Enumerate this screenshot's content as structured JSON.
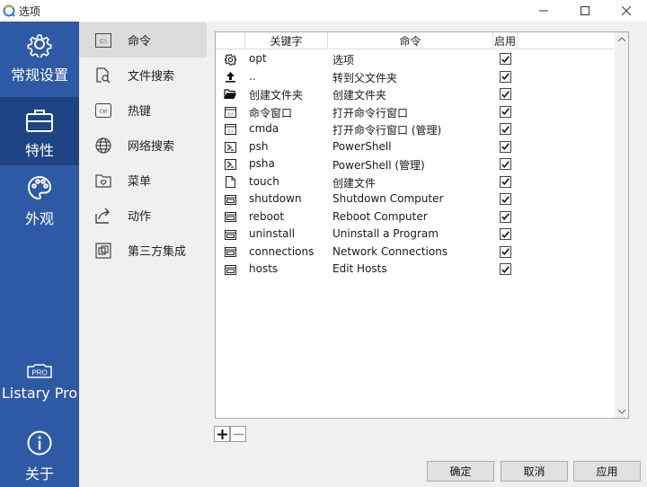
{
  "window": {
    "title": "选项"
  },
  "sidebar": {
    "items": [
      {
        "label": "常规设置",
        "icon": "gear-icon"
      },
      {
        "label": "特性",
        "icon": "briefcase-icon"
      },
      {
        "label": "外观",
        "icon": "palette-icon"
      },
      {
        "label": "Listary Pro",
        "icon": "pro-badge-icon",
        "badge": "PRO"
      },
      {
        "label": "关于",
        "icon": "info-icon"
      }
    ],
    "active_index": 1
  },
  "subnav": {
    "items": [
      {
        "label": "命令",
        "icon": "command-window-icon"
      },
      {
        "label": "文件搜索",
        "icon": "file-search-icon"
      },
      {
        "label": "热键",
        "icon": "keyboard-key-icon",
        "badge": "Ctrl"
      },
      {
        "label": "网络搜索",
        "icon": "globe-icon"
      },
      {
        "label": "菜单",
        "icon": "folder-heart-icon"
      },
      {
        "label": "动作",
        "icon": "share-arrow-icon"
      },
      {
        "label": "第三方集成",
        "icon": "windows-stack-icon"
      }
    ],
    "active_index": 0
  },
  "table": {
    "headers": [
      "关键字",
      "命令",
      "启用"
    ],
    "rows": [
      {
        "icon": "gear-icon",
        "keyword": "opt",
        "command": "选项",
        "enabled": true
      },
      {
        "icon": "up-arrow-icon",
        "keyword": "..",
        "command": "转到父文件夹",
        "enabled": true
      },
      {
        "icon": "open-folder-icon",
        "keyword": "创建文件夹",
        "command": "创建文件夹",
        "enabled": true
      },
      {
        "icon": "cmd-icon",
        "keyword": "命令窗口",
        "command": "打开命令行窗口",
        "enabled": true
      },
      {
        "icon": "cmd-icon",
        "keyword": "cmda",
        "command": "打开命令行窗口 (管理)",
        "enabled": true
      },
      {
        "icon": "powershell-icon",
        "keyword": "psh",
        "command": "PowerShell",
        "enabled": true
      },
      {
        "icon": "powershell-icon",
        "keyword": "psha",
        "command": "PowerShell (管理)",
        "enabled": true
      },
      {
        "icon": "file-icon",
        "keyword": "touch",
        "command": "创建文件",
        "enabled": true
      },
      {
        "icon": "run-window-icon",
        "keyword": "shutdown",
        "command": "Shutdown Computer",
        "enabled": true
      },
      {
        "icon": "run-window-icon",
        "keyword": "reboot",
        "command": "Reboot Computer",
        "enabled": true
      },
      {
        "icon": "run-window-icon",
        "keyword": "uninstall",
        "command": "Uninstall a Program",
        "enabled": true
      },
      {
        "icon": "run-window-icon",
        "keyword": "connections",
        "command": "Network Connections",
        "enabled": true
      },
      {
        "icon": "run-window-icon",
        "keyword": "hosts",
        "command": "Edit Hosts",
        "enabled": true
      }
    ]
  },
  "footer": {
    "ok": "确定",
    "cancel": "取消",
    "apply": "应用"
  },
  "colors": {
    "sidebar": "#2e5aa5",
    "sidebar_active": "#1f4485",
    "subnav": "#f0f0f0",
    "subnav_active": "#dcdcdc"
  }
}
